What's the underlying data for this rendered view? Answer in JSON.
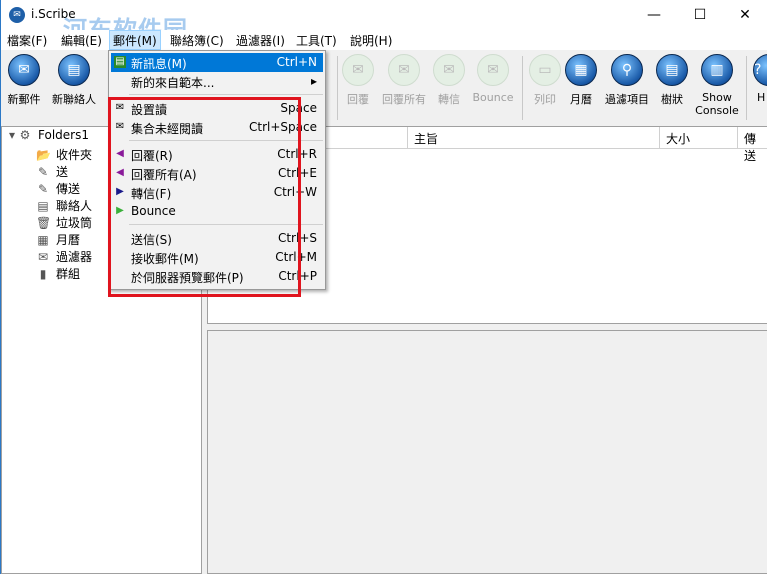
{
  "window": {
    "title": "i.Scribe",
    "watermark": "河东软件园",
    "minimize": "—",
    "maximize": "☐",
    "close": "✕"
  },
  "menubar": [
    "檔案(F)",
    "編輯(E)",
    "郵件(M)",
    "聯絡簿(C)",
    "過濾器(I)",
    "工具(T)",
    "說明(H)"
  ],
  "toolbar": [
    {
      "label": "新郵件",
      "icon": "mail-icon",
      "enabled": true
    },
    {
      "label": "新聯絡人",
      "icon": "contact-card-icon",
      "enabled": true
    },
    {
      "label": "回覆",
      "icon": "reply-icon",
      "enabled": false
    },
    {
      "label": "回覆所有",
      "icon": "reply-all-icon",
      "enabled": false
    },
    {
      "label": "轉信",
      "icon": "forward-icon",
      "enabled": false
    },
    {
      "label": "Bounce",
      "icon": "bounce-icon",
      "enabled": false
    },
    {
      "label": "列印",
      "icon": "print-icon",
      "enabled": false
    },
    {
      "label": "月曆",
      "icon": "calendar-icon",
      "enabled": true
    },
    {
      "label": "過濾項目",
      "icon": "magnifier-icon",
      "enabled": true
    },
    {
      "label": "樹狀",
      "icon": "tree-icon",
      "enabled": true
    },
    {
      "label": "Show Console",
      "icon": "console-icon",
      "enabled": true
    },
    {
      "label": "H",
      "icon": "help-icon",
      "enabled": true
    }
  ],
  "tree": {
    "root": "Folders1",
    "items": [
      "收件夾",
      "送",
      "傳送",
      "聯絡人",
      "垃圾筒",
      "月曆",
      "過濾器",
      "群組"
    ]
  },
  "list": {
    "columns": [
      "主旨",
      "大小",
      "傳送"
    ]
  },
  "popup": {
    "items": [
      {
        "label": "新訊息(M)",
        "shortcut": "Ctrl+N",
        "highlighted": true
      },
      {
        "label": "新的來自範本...",
        "shortcut": "▸"
      },
      {
        "label": "設置讀",
        "shortcut": "Space"
      },
      {
        "label": "集合未經閱讀",
        "shortcut": "Ctrl+Space"
      },
      {
        "label": "回覆(R)",
        "shortcut": "Ctrl+R"
      },
      {
        "label": "回覆所有(A)",
        "shortcut": "Ctrl+E"
      },
      {
        "label": "轉信(F)",
        "shortcut": "Ctrl+W"
      },
      {
        "label": "Bounce",
        "shortcut": ""
      },
      {
        "label": "送信(S)",
        "shortcut": "Ctrl+S"
      },
      {
        "label": "接收郵件(M)",
        "shortcut": "Ctrl+M"
      },
      {
        "label": "於伺服器預覽郵件(P)",
        "shortcut": "Ctrl+P"
      }
    ]
  },
  "colors": {
    "highlight": "#0078d7",
    "annotation_box": "#e0141e"
  }
}
